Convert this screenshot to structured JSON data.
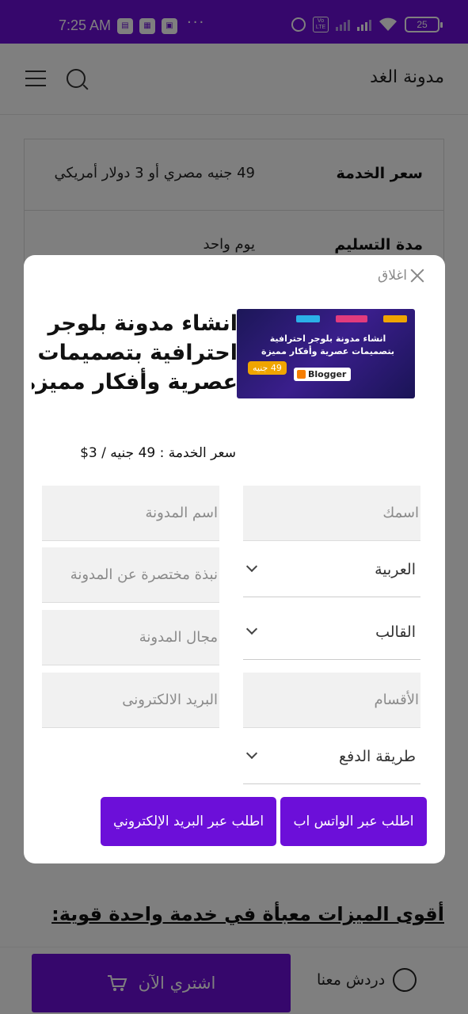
{
  "status_bar": {
    "time": "7:25 AM",
    "battery": "25",
    "volte": "Vo LTE"
  },
  "header": {
    "brand": "مدونة الغد"
  },
  "specs": [
    {
      "label": "سعر الخدمة",
      "value": "49 جنيه مصري أو 3 دولار أمريكي"
    },
    {
      "label": "مدة التسليم",
      "value": "يوم واحد"
    }
  ],
  "background": {
    "features_link": "أقوى الميزات معبأة في خدمة واحدة قوية:"
  },
  "bottom_bar": {
    "buy_label": "اشتري الآن",
    "chat_label": "دردش معنا"
  },
  "modal": {
    "close_label": "اغلاق",
    "title": "انشاء مدونة بلوجر احترافية بتصميمات عصرية وأفكار مميزة",
    "title_lines": [
      "انشاء مدونة بلوجر",
      "احترافية بتصميمات",
      "عصرية وأفكار مميزة"
    ],
    "price": "سعر الخدمة : 49 جنيه / 3$",
    "thumbnail": {
      "headline": "انشاء مدونة بلوجر احترافية بتصميمات عصرية وأفكار مميزة",
      "brand": "Blogger",
      "badge": "49 جنيه"
    },
    "fields": {
      "name_placeholder": "اسمك",
      "blog_name_placeholder": "اسم المدونة",
      "language_value": "العربية",
      "bio_placeholder": "نبذة مختصرة عن المدونة",
      "template_value": "القالب",
      "niche_placeholder": "مجال المدونة",
      "sections_placeholder": "الأقسام",
      "email_placeholder": "البريد الالكترونى",
      "payment_value": "طريقة الدفع"
    },
    "buttons": {
      "whatsapp": "اطلب عبر الواتس اب",
      "email": "اطلب عبر البريد الإلكتروني"
    }
  },
  "colors": {
    "accent": "#6c0fd9"
  }
}
